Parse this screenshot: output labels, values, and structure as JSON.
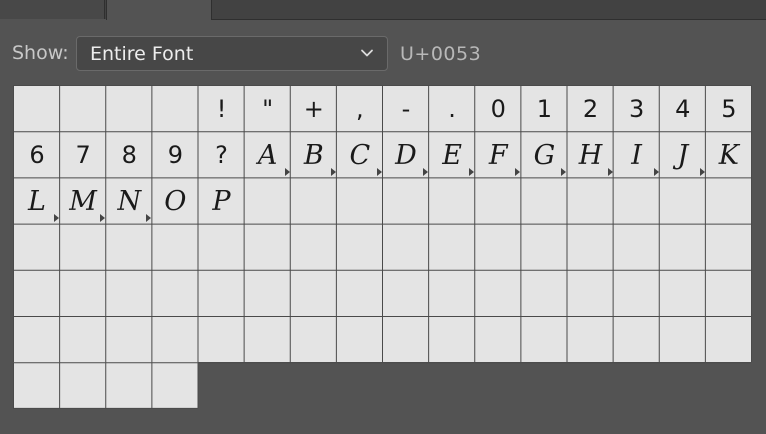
{
  "toolbar": {
    "show_label": "Show:",
    "show_value": "Entire Font",
    "codepoint": "U+0053"
  },
  "glyphs": [
    {
      "char": "",
      "alternates": false
    },
    {
      "char": "",
      "alternates": false
    },
    {
      "char": "",
      "alternates": false
    },
    {
      "char": "",
      "alternates": false
    },
    {
      "char": "!",
      "alternates": false
    },
    {
      "char": "\"",
      "alternates": false
    },
    {
      "char": "+",
      "alternates": false
    },
    {
      "char": ",",
      "alternates": false
    },
    {
      "char": "-",
      "alternates": false
    },
    {
      "char": ".",
      "alternates": false
    },
    {
      "char": "0",
      "alternates": false
    },
    {
      "char": "1",
      "alternates": false
    },
    {
      "char": "2",
      "alternates": false
    },
    {
      "char": "3",
      "alternates": false
    },
    {
      "char": "4",
      "alternates": false
    },
    {
      "char": "5",
      "alternates": false
    },
    {
      "char": "6",
      "alternates": false
    },
    {
      "char": "7",
      "alternates": false
    },
    {
      "char": "8",
      "alternates": false
    },
    {
      "char": "9",
      "alternates": false
    },
    {
      "char": "?",
      "alternates": false
    },
    {
      "char": "A",
      "alternates": true
    },
    {
      "char": "B",
      "alternates": true
    },
    {
      "char": "C",
      "alternates": true
    },
    {
      "char": "D",
      "alternates": true
    },
    {
      "char": "E",
      "alternates": true
    },
    {
      "char": "F",
      "alternates": true
    },
    {
      "char": "G",
      "alternates": true
    },
    {
      "char": "H",
      "alternates": true
    },
    {
      "char": "I",
      "alternates": true
    },
    {
      "char": "J",
      "alternates": true
    },
    {
      "char": "K",
      "alternates": false
    },
    {
      "char": "L",
      "alternates": true
    },
    {
      "char": "M",
      "alternates": true
    },
    {
      "char": "N",
      "alternates": true
    },
    {
      "char": "O",
      "alternates": false
    },
    {
      "char": "P",
      "alternates": false
    }
  ]
}
